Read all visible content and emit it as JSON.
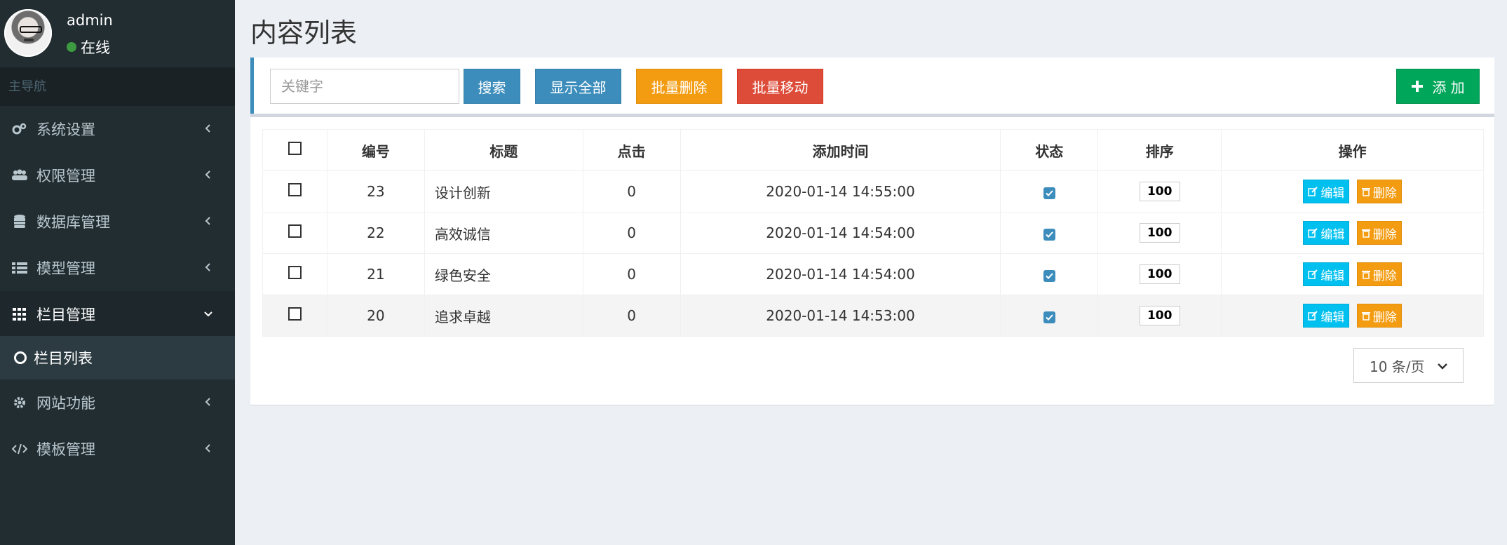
{
  "user": {
    "name": "admin",
    "status": "在线"
  },
  "sidebar": {
    "header": "主导航",
    "items": [
      {
        "label": "系统设置",
        "icon": "cogs-icon"
      },
      {
        "label": "权限管理",
        "icon": "users-icon"
      },
      {
        "label": "数据库管理",
        "icon": "database-icon"
      },
      {
        "label": "模型管理",
        "icon": "list-icon"
      },
      {
        "label": "栏目管理",
        "icon": "grid-icon"
      },
      {
        "label": "网站功能",
        "icon": "gear-icon"
      },
      {
        "label": "模板管理",
        "icon": "code-icon"
      }
    ],
    "submenu": {
      "label": "栏目列表"
    }
  },
  "page": {
    "title": "内容列表"
  },
  "toolbar": {
    "search_placeholder": "关键字",
    "search_label": "搜索",
    "show_all_label": "显示全部",
    "batch_delete_label": "批量删除",
    "batch_move_label": "批量移动",
    "add_label": "添 加"
  },
  "table": {
    "headers": [
      "编号",
      "标题",
      "点击",
      "添加时间",
      "状态",
      "排序",
      "操作"
    ],
    "edit_label": "编辑",
    "delete_label": "删除",
    "rows": [
      {
        "id": "23",
        "title": "设计创新",
        "clicks": "0",
        "time": "2020-01-14 14:55:00",
        "sort": "100"
      },
      {
        "id": "22",
        "title": "高效诚信",
        "clicks": "0",
        "time": "2020-01-14 14:54:00",
        "sort": "100"
      },
      {
        "id": "21",
        "title": "绿色安全",
        "clicks": "0",
        "time": "2020-01-14 14:54:00",
        "sort": "100"
      },
      {
        "id": "20",
        "title": "追求卓越",
        "clicks": "0",
        "time": "2020-01-14 14:53:00",
        "sort": "100"
      }
    ]
  },
  "pager": {
    "page_size": "10 条/页"
  },
  "colors": {
    "sidebar_bg": "#222d32",
    "primary": "#3c8dbc",
    "warning": "#f39c12",
    "danger": "#dd4b39",
    "success": "#00a65a",
    "info": "#00c0ef"
  }
}
